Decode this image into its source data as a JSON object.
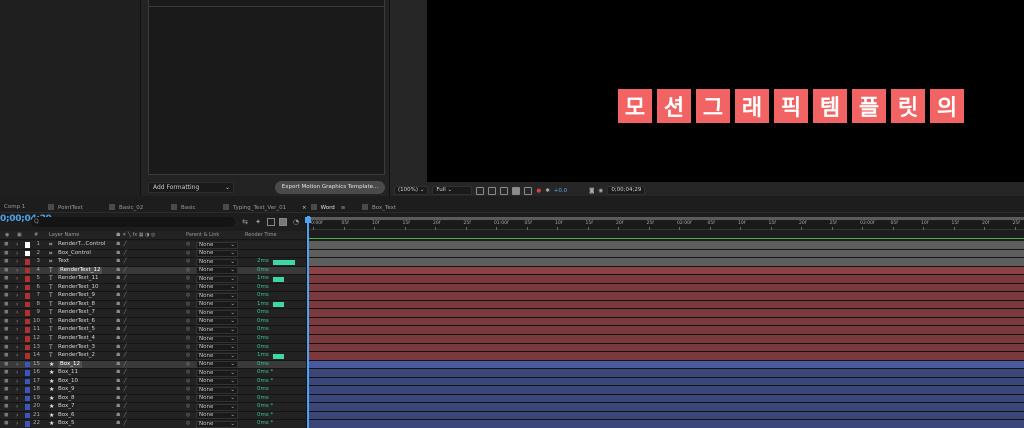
{
  "egp": {
    "add_formatting": "Add Formatting",
    "export_button": "Export Motion Graphics Template..."
  },
  "viewer": {
    "title_chars": [
      "모",
      "션",
      "그",
      "래",
      "픽",
      "템",
      "플",
      "릿",
      "의"
    ],
    "title_bg_color": "#f26363",
    "zoom": "(100%)",
    "resolution": "Full",
    "exposure": "+0.0",
    "timecode": "0;00;04;29"
  },
  "tabs": [
    {
      "label": "Comp 1"
    },
    {
      "label": "PointText"
    },
    {
      "label": "Basic_02"
    },
    {
      "label": "Basic"
    },
    {
      "label": "Typing_Text_Ver_01"
    },
    {
      "label": "Word",
      "active": true
    },
    {
      "label": "Box_Text"
    }
  ],
  "timeline": {
    "current_time": "0;00;04;29",
    "search_placeholder": "Q"
  },
  "columns": {
    "num": "#",
    "layer_name": "Layer Name",
    "parent_link": "Parent & Link",
    "render_time": "Render Time"
  },
  "ruler_ticks": [
    "0:00f",
    "05f",
    "10f",
    "15f",
    "20f",
    "25f",
    "01:00f",
    "05f",
    "10f",
    "15f",
    "20f",
    "25f",
    "02:00f",
    "05f",
    "10f",
    "15f",
    "20f",
    "25f",
    "03:00f",
    "05f",
    "10f",
    "15f",
    "20f",
    "25f"
  ],
  "layers": [
    {
      "num": "1",
      "type": "null",
      "name": "RenderT...Control",
      "label_color": "#ffffff",
      "parent": "None",
      "render": "",
      "bar": 0,
      "track": "gray"
    },
    {
      "num": "2",
      "type": "null",
      "name": "Box_Control",
      "label_color": "#ffffff",
      "parent": "None",
      "render": "",
      "bar": 0,
      "track": "gray"
    },
    {
      "num": "3",
      "type": "null",
      "name": "Text",
      "label_color": "#b03030",
      "parent": "None",
      "render": "2ms",
      "bar": 0.8,
      "track": "gray"
    },
    {
      "num": "4",
      "type": "text",
      "name": "RenderText_12",
      "label_color": "#b03030",
      "parent": "None",
      "render": "0ms",
      "bar": 0,
      "track": "red",
      "selected": true
    },
    {
      "num": "5",
      "type": "text",
      "name": "RenderText_11",
      "label_color": "#b03030",
      "parent": "None",
      "render": "1ms",
      "bar": 0.4,
      "track": "red"
    },
    {
      "num": "6",
      "type": "text",
      "name": "RenderText_10",
      "label_color": "#b03030",
      "parent": "None",
      "render": "0ms",
      "bar": 0,
      "track": "red"
    },
    {
      "num": "7",
      "type": "text",
      "name": "RenderText_9",
      "label_color": "#b03030",
      "parent": "None",
      "render": "0ms",
      "bar": 0,
      "track": "red"
    },
    {
      "num": "8",
      "type": "text",
      "name": "RenderText_8",
      "label_color": "#b03030",
      "parent": "None",
      "render": "1ms",
      "bar": 0.4,
      "track": "red"
    },
    {
      "num": "9",
      "type": "text",
      "name": "RenderText_7",
      "label_color": "#b03030",
      "parent": "None",
      "render": "0ms",
      "bar": 0,
      "track": "red"
    },
    {
      "num": "10",
      "type": "text",
      "name": "RenderText_6",
      "label_color": "#b03030",
      "parent": "None",
      "render": "0ms",
      "bar": 0,
      "track": "red"
    },
    {
      "num": "11",
      "type": "text",
      "name": "RenderText_5",
      "label_color": "#b03030",
      "parent": "None",
      "render": "0ms",
      "bar": 0,
      "track": "red"
    },
    {
      "num": "12",
      "type": "text",
      "name": "RenderText_4",
      "label_color": "#b03030",
      "parent": "None",
      "render": "0ms",
      "bar": 0,
      "track": "red"
    },
    {
      "num": "13",
      "type": "text",
      "name": "RenderText_3",
      "label_color": "#b03030",
      "parent": "None",
      "render": "0ms",
      "bar": 0,
      "track": "red"
    },
    {
      "num": "14",
      "type": "text",
      "name": "RenderText_2",
      "label_color": "#b03030",
      "parent": "None",
      "render": "1ms",
      "bar": 0.4,
      "track": "red"
    },
    {
      "num": "15",
      "type": "shape",
      "name": "Box_12",
      "label_color": "#3a55c0",
      "parent": "None",
      "render": "0ms",
      "bar": 0,
      "track": "blue",
      "selected": true
    },
    {
      "num": "16",
      "type": "shape",
      "name": "Box_11",
      "label_color": "#3a55c0",
      "parent": "None",
      "render": "0ms *",
      "bar": 0,
      "track": "blue"
    },
    {
      "num": "17",
      "type": "shape",
      "name": "Box_10",
      "label_color": "#3a55c0",
      "parent": "None",
      "render": "0ms *",
      "bar": 0,
      "track": "blue"
    },
    {
      "num": "18",
      "type": "shape",
      "name": "Box_9",
      "label_color": "#3a55c0",
      "parent": "None",
      "render": "0ms",
      "bar": 0,
      "track": "blue"
    },
    {
      "num": "19",
      "type": "shape",
      "name": "Box_8",
      "label_color": "#3a55c0",
      "parent": "None",
      "render": "0ms",
      "bar": 0,
      "track": "blue"
    },
    {
      "num": "20",
      "type": "shape",
      "name": "Box_7",
      "label_color": "#3a55c0",
      "parent": "None",
      "render": "0ms *",
      "bar": 0,
      "track": "blue"
    },
    {
      "num": "21",
      "type": "shape",
      "name": "Box_6",
      "label_color": "#3a55c0",
      "parent": "None",
      "render": "0ms *",
      "bar": 0,
      "track": "blue"
    },
    {
      "num": "22",
      "type": "shape",
      "name": "Box_5",
      "label_color": "#3a55c0",
      "parent": "None",
      "render": "0ms *",
      "bar": 0,
      "track": "blue"
    }
  ]
}
